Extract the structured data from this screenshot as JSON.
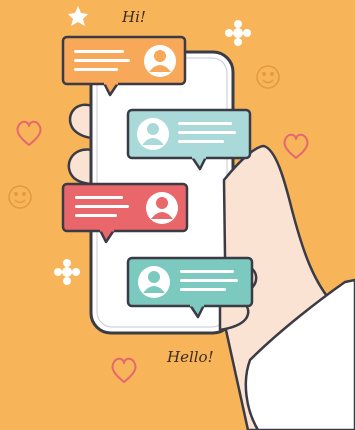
{
  "illustration": {
    "caption_top": "Hi!",
    "caption_bottom": "Hello!",
    "colors": {
      "background": "#f7b459",
      "phone_screen": "#ffffff",
      "outline": "#3b3b45",
      "bubble_orange": "#f7a858",
      "bubble_teal_light": "#a9d9d8",
      "bubble_red": "#e9666a",
      "bubble_teal": "#7cc9bf",
      "hand": "#fbe3d3",
      "heart": "#e5686e"
    },
    "icons": [
      "sparkle-icon",
      "heart-icon",
      "smiley-icon",
      "avatar-icon"
    ],
    "messages": [
      {
        "side": "left",
        "color": "orange"
      },
      {
        "side": "right",
        "color": "teal-light"
      },
      {
        "side": "left",
        "color": "red"
      },
      {
        "side": "right",
        "color": "teal"
      }
    ]
  }
}
